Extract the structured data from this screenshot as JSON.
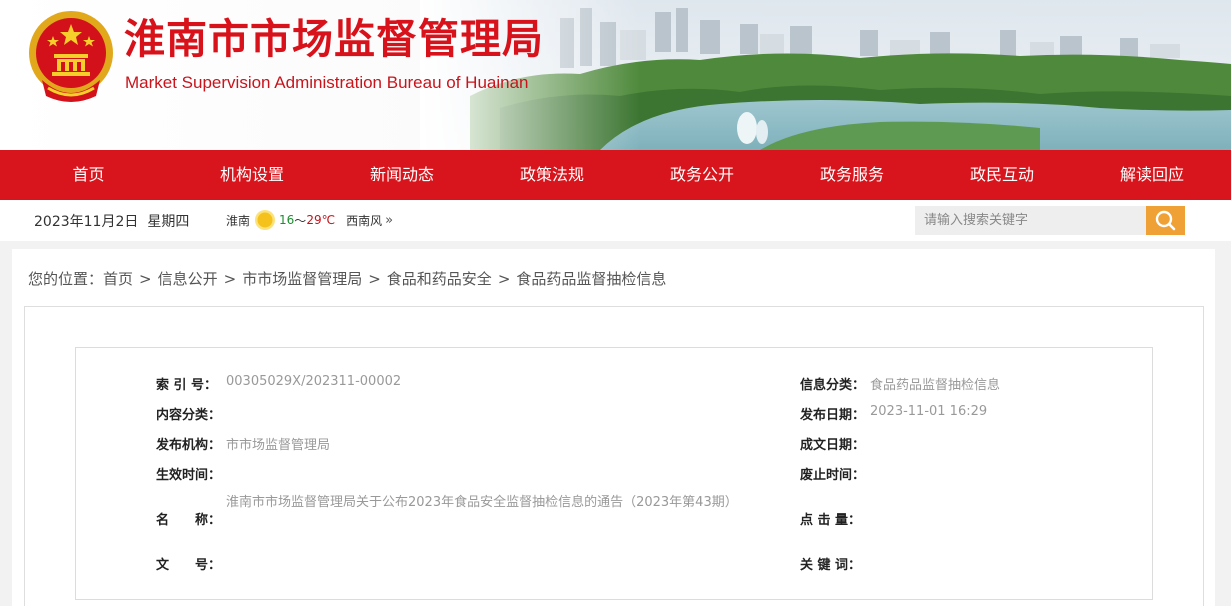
{
  "header": {
    "title": "淮南市市场监督管理局",
    "subtitle": "Market Supervision Administration Bureau of Huainan"
  },
  "nav": [
    "首页",
    "机构设置",
    "新闻动态",
    "政策法规",
    "政务公开",
    "政务服务",
    "政民互动",
    "解读回应"
  ],
  "infobar": {
    "date": "2023年11月2日",
    "weekday": "星期四",
    "city": "淮南",
    "temp_low": "16",
    "temp_sep": "～",
    "temp_high": "29℃",
    "wind": "西南风",
    "more": "»"
  },
  "search": {
    "placeholder": "请输入搜索关键字"
  },
  "breadcrumb": {
    "prefix": "您的位置：",
    "items": [
      "首页",
      "信息公开",
      "市市场监督管理局",
      "食品和药品安全",
      "食品药品监督抽检信息"
    ],
    "separator": ">"
  },
  "meta": {
    "index_label": "索 引 号：",
    "index_value": "00305029X/202311-00002",
    "category_label": "信息分类：",
    "category_value": "食品药品监督抽检信息",
    "content_label": "内容分类：",
    "content_value": "",
    "pubdate_label": "发布日期：",
    "pubdate_value": "2023-11-01 16:29",
    "org_label": "发布机构：",
    "org_value": "市市场监督管理局",
    "written_label": "成文日期：",
    "written_value": "",
    "effective_label": "生效时间：",
    "effective_value": "",
    "expire_label": "废止时间：",
    "expire_value": "",
    "name_label": "名　　称：",
    "name_value": "淮南市市场监督管理局关于公布2023年食品安全监督抽检信息的通告（2023年第43期）",
    "clicks_label": "点 击 量：",
    "clicks_value": "",
    "docno_label": "文　　号：",
    "docno_value": "",
    "keywords_label": "关 键 词：",
    "keywords_value": ""
  },
  "colors": {
    "brand_red": "#d8151c",
    "search_orange": "#f0a135"
  }
}
